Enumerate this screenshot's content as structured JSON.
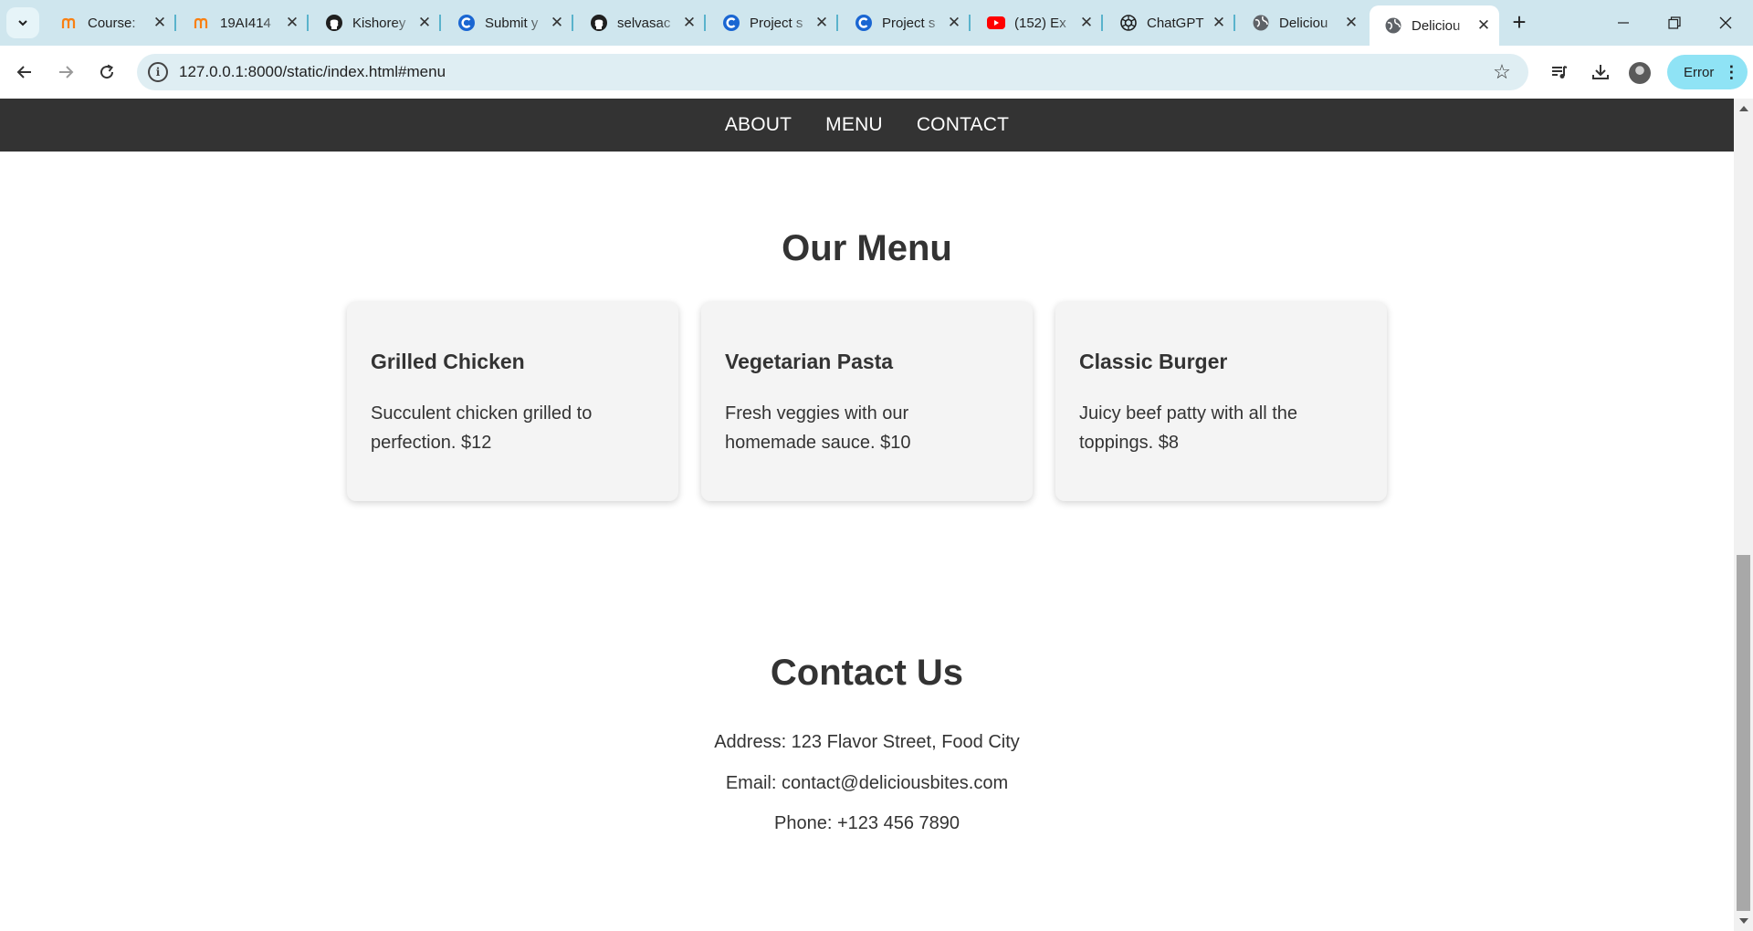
{
  "browser": {
    "tabs": [
      {
        "title": "Course:",
        "icon": "moodle-icon"
      },
      {
        "title": "19AI414",
        "icon": "moodle-icon"
      },
      {
        "title": "Kishorey",
        "icon": "github-icon"
      },
      {
        "title": "Submit y",
        "icon": "c-icon"
      },
      {
        "title": "selvasac",
        "icon": "github-icon"
      },
      {
        "title": "Project s",
        "icon": "c-icon"
      },
      {
        "title": "Project s",
        "icon": "c-icon"
      },
      {
        "title": "(152) Ex",
        "icon": "youtube-icon"
      },
      {
        "title": "ChatGPT",
        "icon": "chatgpt-icon"
      },
      {
        "title": "Deliciou",
        "icon": "globe-icon"
      },
      {
        "title": "Deliciou",
        "icon": "globe-icon"
      }
    ],
    "address": "127.0.0.1:8000/static/index.html#menu",
    "profile_status": "Error"
  },
  "site": {
    "nav": [
      "ABOUT",
      "MENU",
      "CONTACT"
    ],
    "menu": {
      "title": "Our Menu",
      "items": [
        {
          "name": "Grilled Chicken",
          "description": "Succulent chicken grilled to perfection. $12"
        },
        {
          "name": "Vegetarian Pasta",
          "description": "Fresh veggies with our homemade sauce. $10"
        },
        {
          "name": "Classic Burger",
          "description": "Juicy beef patty with all the toppings. $8"
        }
      ]
    },
    "contact": {
      "title": "Contact Us",
      "address": "Address: 123 Flavor Street, Food City",
      "email": "Email: contact@deliciousbites.com",
      "phone": "Phone: +123 456 7890"
    }
  },
  "colors": {
    "nav_bg": "#333333",
    "card_bg": "#f4f4f4",
    "text": "#333333",
    "tabstrip_bg": "#cfe6ee",
    "error_pill": "#8fe3f5"
  }
}
